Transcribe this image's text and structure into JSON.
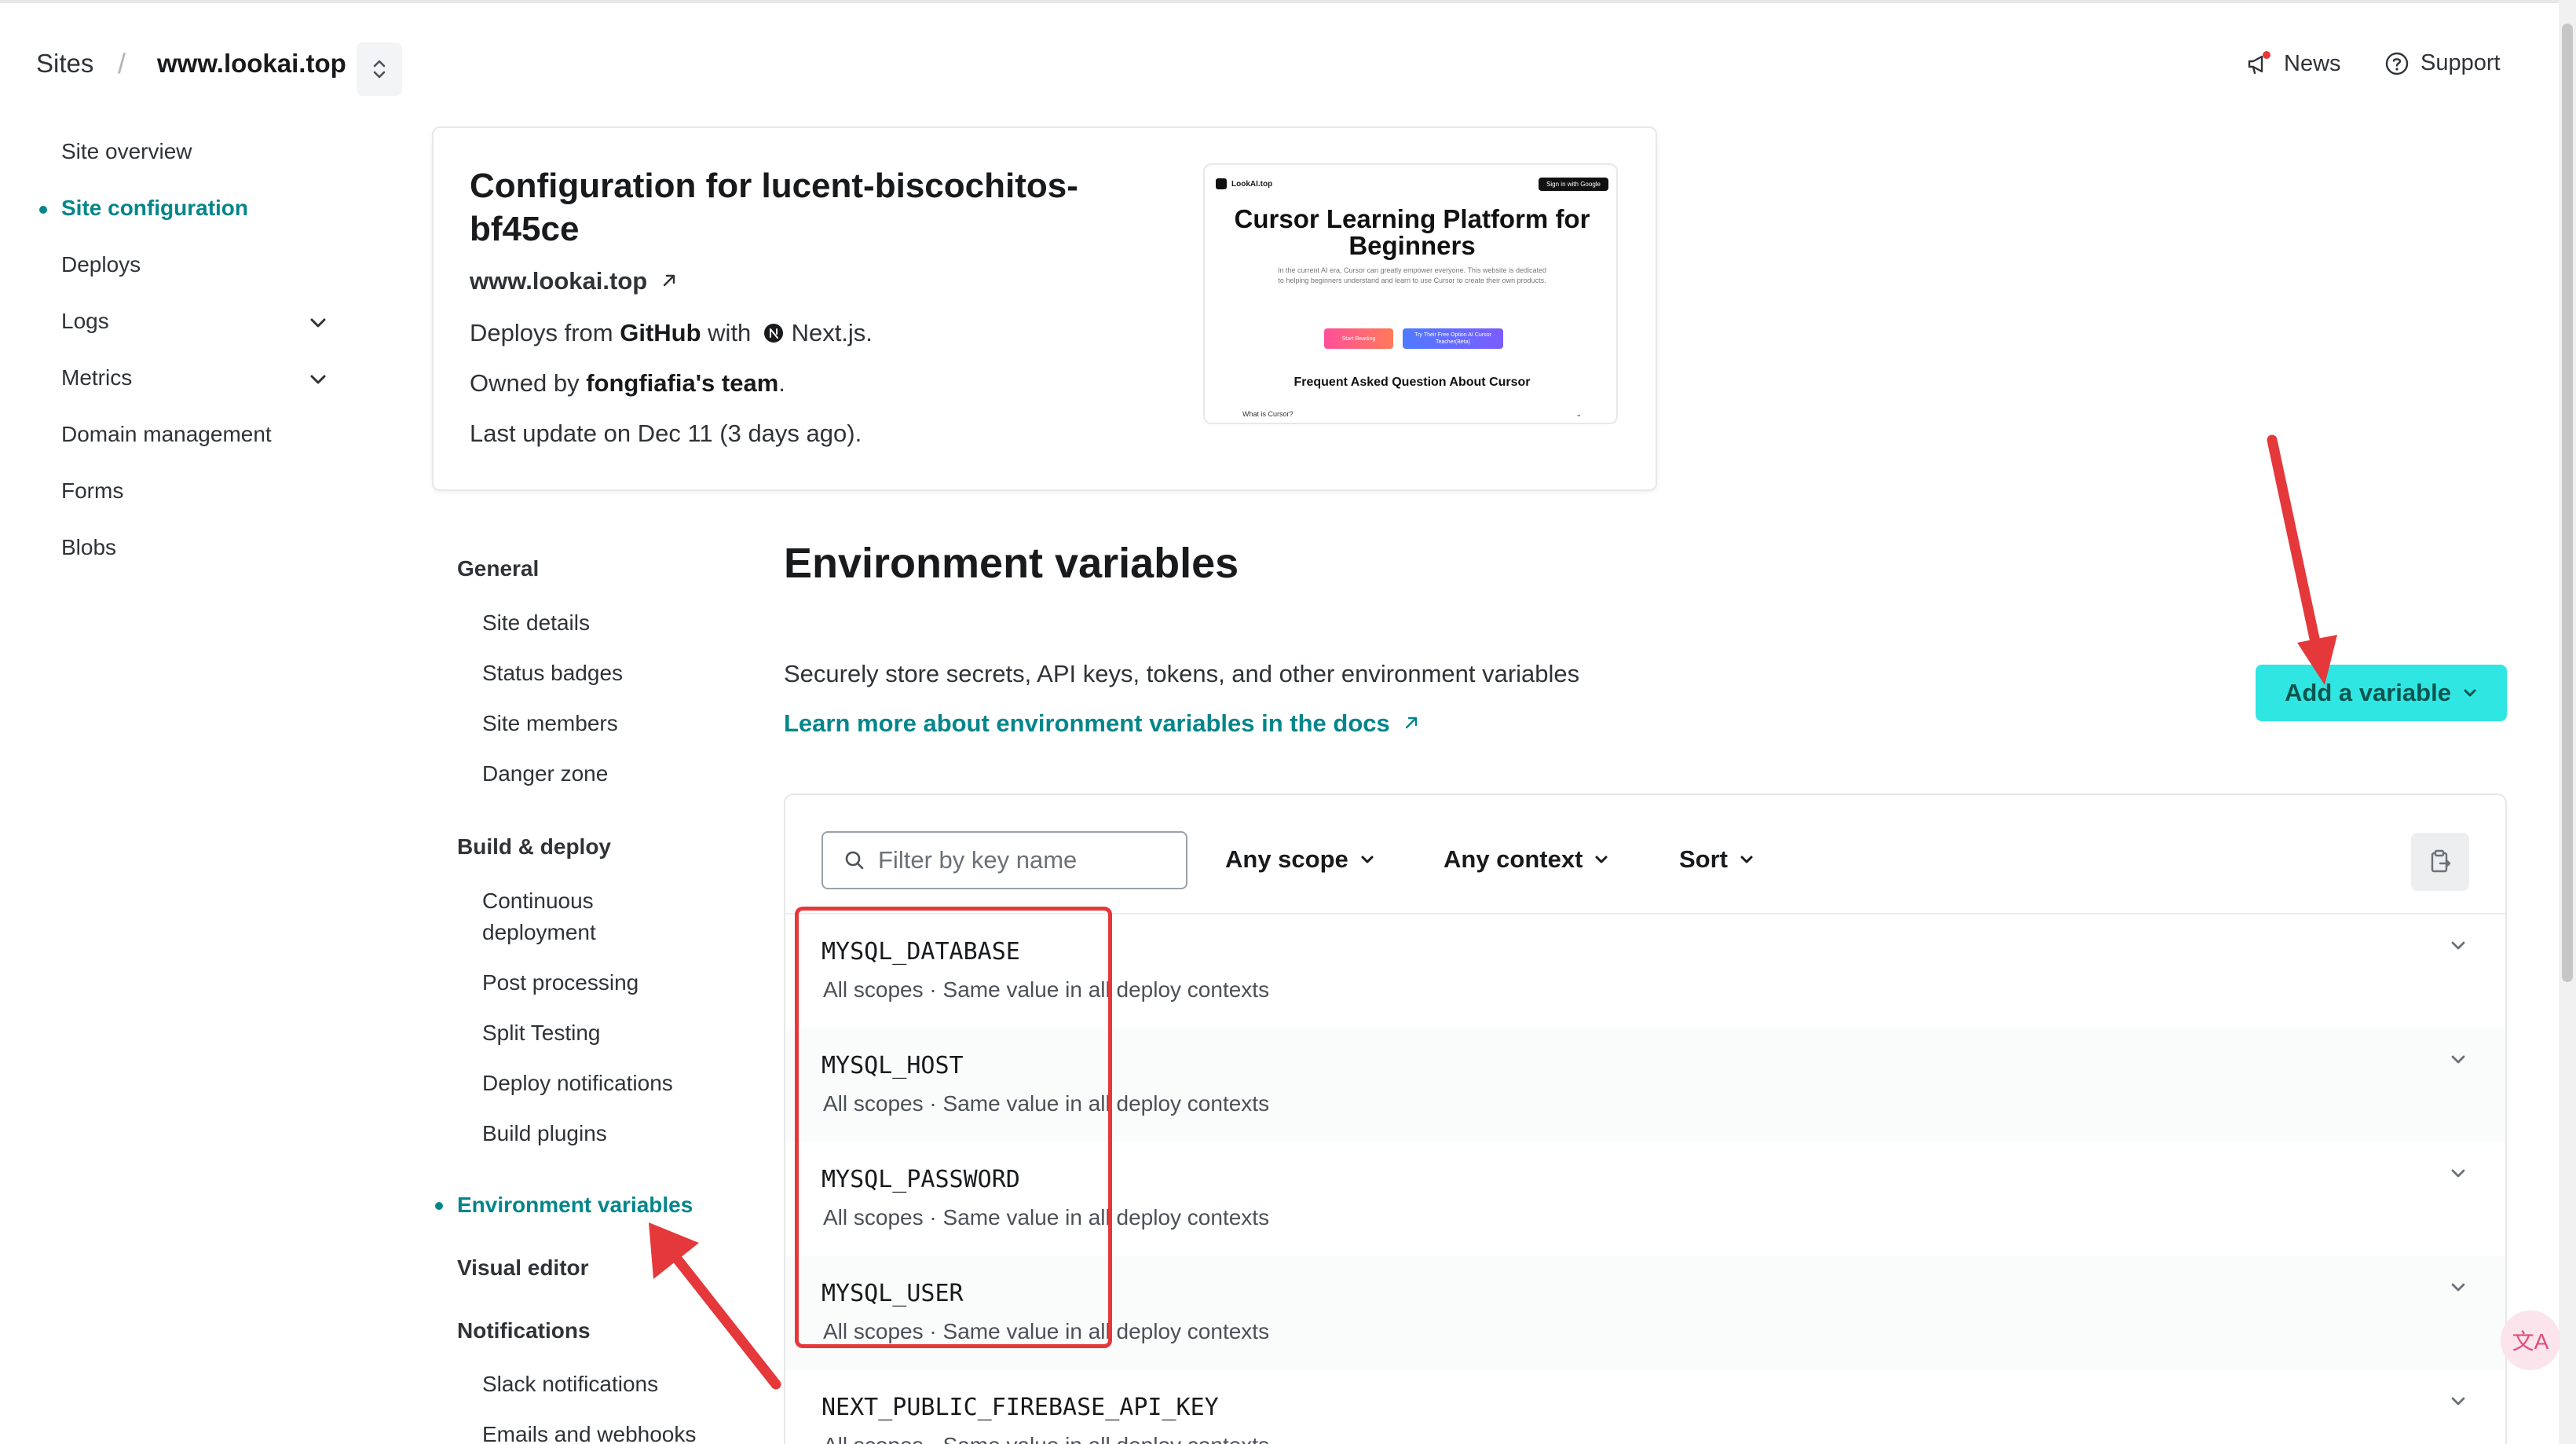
{
  "header": {
    "breadcrumb_sites": "Sites",
    "breadcrumb_separator": "/",
    "site_name": "www.lookai.top",
    "news_label": "News",
    "support_label": "Support"
  },
  "left_nav": {
    "items": [
      {
        "label": "Site overview"
      },
      {
        "label": "Site configuration",
        "active": true
      },
      {
        "label": "Deploys"
      },
      {
        "label": "Logs",
        "expandable": true
      },
      {
        "label": "Metrics",
        "expandable": true
      },
      {
        "label": "Domain management"
      },
      {
        "label": "Forms"
      },
      {
        "label": "Blobs"
      }
    ]
  },
  "site_card": {
    "title": "Configuration for lucent-biscochitos-bf45ce",
    "url": "www.lookai.top",
    "deploys_prefix": "Deploys from",
    "deploys_source": "GitHub",
    "deploys_with": "with",
    "framework": "Next.js.",
    "owned_prefix": "Owned by",
    "owner": "fongfiafia's team",
    "owned_suffix": ".",
    "last_update": "Last update on Dec 11 (3 days ago).",
    "preview": {
      "logo": "LookAI.top",
      "signin": "Sign in with Google",
      "heading": "Cursor Learning Platform for Beginners",
      "paragraph": "In the current AI era, Cursor can greatly empower everyone. This website is dedicated to helping beginners understand and learn to use Cursor to create their own products.",
      "button1": "Start Reading",
      "button2": "Try Their Free Option AI Cursor Teacher(Beta)",
      "faq_heading": "Frequent Asked Question About Cursor",
      "faq_first": "What is Cursor?"
    }
  },
  "settings_nav": {
    "general": "General",
    "general_items": [
      "Site details",
      "Status badges",
      "Site members",
      "Danger zone"
    ],
    "build_deploy": "Build & deploy",
    "build_items": [
      "Continuous deployment",
      "Post processing",
      "Split Testing",
      "Deploy notifications",
      "Build plugins"
    ],
    "env_vars": "Environment variables",
    "visual_editor": "Visual editor",
    "notifications": "Notifications",
    "notification_items": [
      "Slack notifications",
      "Emails and webhooks"
    ]
  },
  "env_section": {
    "title": "Environment variables",
    "description": "Securely store secrets, API keys, tokens, and other environment variables",
    "learn_more": "Learn more about environment variables in the docs",
    "add_button": "Add a variable",
    "filter_placeholder": "Filter by key name",
    "scope_dropdown": "Any scope",
    "context_dropdown": "Any context",
    "sort_dropdown": "Sort",
    "variables": [
      {
        "key": "MYSQL_DATABASE",
        "scopes": "All scopes",
        "separator": "·",
        "contexts": "Same value in all deploy contexts"
      },
      {
        "key": "MYSQL_HOST",
        "scopes": "All scopes",
        "separator": "·",
        "contexts": "Same value in all deploy contexts"
      },
      {
        "key": "MYSQL_PASSWORD",
        "scopes": "All scopes",
        "separator": "·",
        "contexts": "Same value in all deploy contexts"
      },
      {
        "key": "MYSQL_USER",
        "scopes": "All scopes",
        "separator": "·",
        "contexts": "Same value in all deploy contexts"
      },
      {
        "key": "NEXT_PUBLIC_FIREBASE_API_KEY",
        "scopes": "All scopes",
        "separator": "·",
        "contexts": "Same value in all deploy contexts"
      }
    ]
  },
  "colors": {
    "accent": "#03868b",
    "add_button_bg": "#30e6e2",
    "annotation_red": "#e5383b"
  },
  "translate_glyph": "文A"
}
